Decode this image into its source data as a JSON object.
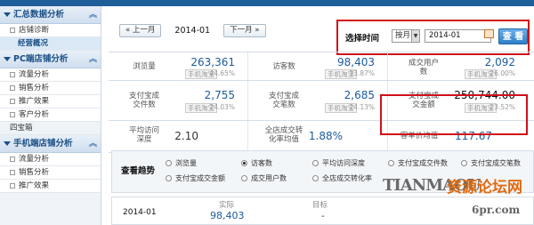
{
  "sidebar": {
    "section1": {
      "title": "汇总数据分析",
      "items": [
        "店铺诊断",
        "经营概况"
      ]
    },
    "section2": {
      "title": "PC端店铺分析",
      "items": [
        "流量分析",
        "销售分析",
        "推广效果",
        "客户分析",
        "四宝箱"
      ]
    },
    "section3": {
      "title": "手机端店铺分析",
      "items": [
        "流量分析",
        "销售分析",
        "推广效果"
      ]
    }
  },
  "nav": {
    "prev": "« 上一月",
    "current": "2014-01",
    "next": "下一月 »"
  },
  "filter": {
    "label": "选择时间",
    "mode": "按月",
    "date": "2014-01",
    "search": "查 看"
  },
  "metrics": [
    {
      "label": "浏览量",
      "value": "263,361",
      "mobile": "手机淘宝",
      "pct": "44.65%"
    },
    {
      "label": "访客数",
      "value": "98,403",
      "mobile": "手机淘宝",
      "pct": "33.87%"
    },
    {
      "label": "成交用户数",
      "value": "2,092",
      "mobile": "手机淘宝",
      "pct": "26.00%"
    },
    {
      "label": "支付宝成交件数",
      "value": "2,755",
      "mobile": "手机淘宝",
      "pct": "24.03%"
    },
    {
      "label": "支付宝成交笔数",
      "value": "2,685",
      "mobile": "手机淘宝",
      "pct": "24.13%"
    },
    {
      "label": "支付宝成交金额",
      "value": "250,744.00",
      "mobile": "手机淘宝",
      "pct": "23.52%"
    },
    {
      "label": "平均访问深度",
      "value": "2.10"
    },
    {
      "label": "全店成交转化率均值",
      "value": "1.88%"
    },
    {
      "label": "客单价均值",
      "value": "117.67"
    }
  ],
  "trend": {
    "label": "查看趋势",
    "options": [
      "浏览量",
      "访客数",
      "平均访问深度",
      "支付宝成交件数",
      "支付宝成交笔数",
      "支付宝成交金额",
      "成交用户数",
      "全店成交转化率"
    ],
    "selected": "访客数"
  },
  "bottom": {
    "date": "2014-01",
    "actual_label": "实际",
    "actual": "98,403",
    "target_label": "目标",
    "target": "-"
  },
  "watermark": {
    "text1": "TIANMAOU",
    "text2": "资源论坛网",
    "text3": "6pr.com"
  }
}
